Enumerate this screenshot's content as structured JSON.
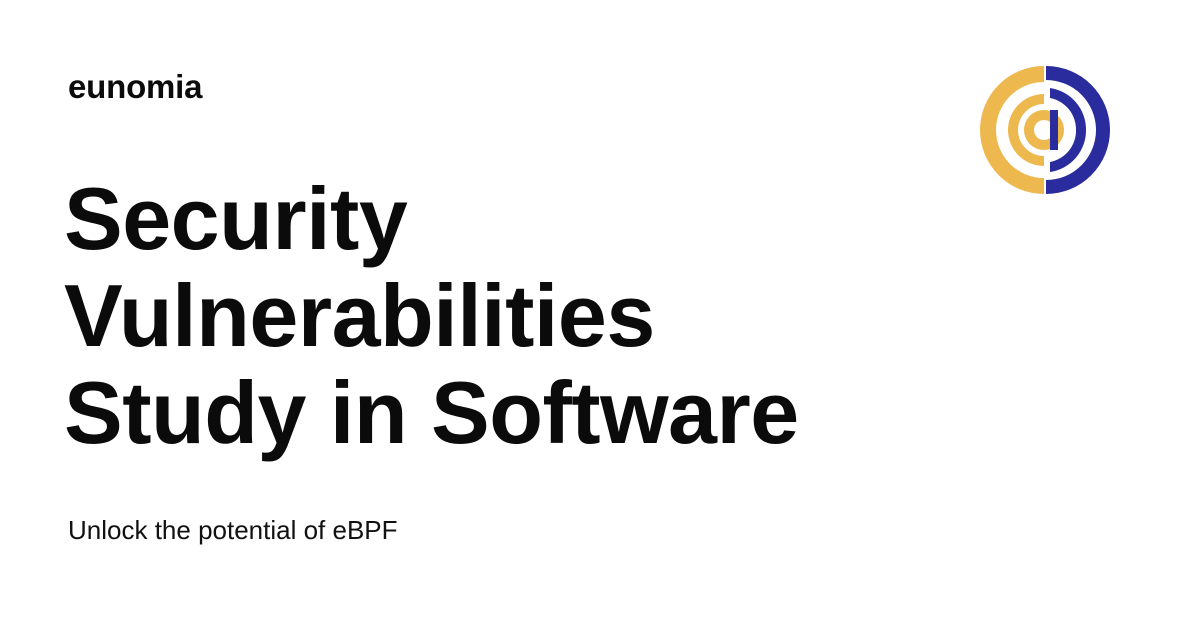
{
  "brand": {
    "site_name": "eunomia",
    "logo_icon": "eunomia-logo-icon",
    "colors": {
      "logo_gold": "#EDB84E",
      "logo_navy": "#2A2C9E"
    }
  },
  "headline": {
    "lines": [
      "Security",
      "Vulnerabilities",
      "Study in Software"
    ]
  },
  "description": "Unlock the potential of eBPF"
}
